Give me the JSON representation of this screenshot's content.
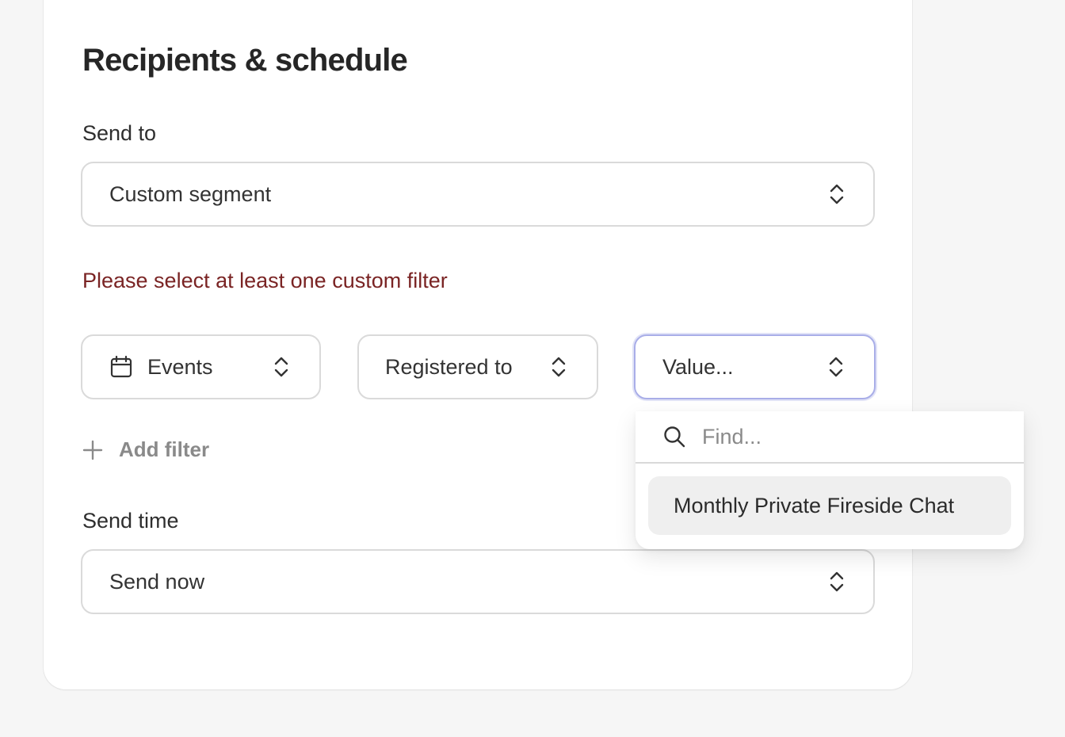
{
  "section": {
    "title": "Recipients & schedule"
  },
  "send_to": {
    "label": "Send to",
    "value": "Custom segment"
  },
  "error_message": "Please select at least one custom filter",
  "filter": {
    "field": "Events",
    "operator": "Registered to",
    "value_placeholder": "Value..."
  },
  "add_filter_label": "Add filter",
  "dropdown": {
    "search_placeholder": "Find...",
    "options": [
      "Monthly Private Fireside Chat"
    ]
  },
  "send_time": {
    "label": "Send time",
    "value": "Send now"
  },
  "colors": {
    "error": "#7a2424",
    "focus_ring": "#a9aee8",
    "option_highlight": "#efefef"
  }
}
